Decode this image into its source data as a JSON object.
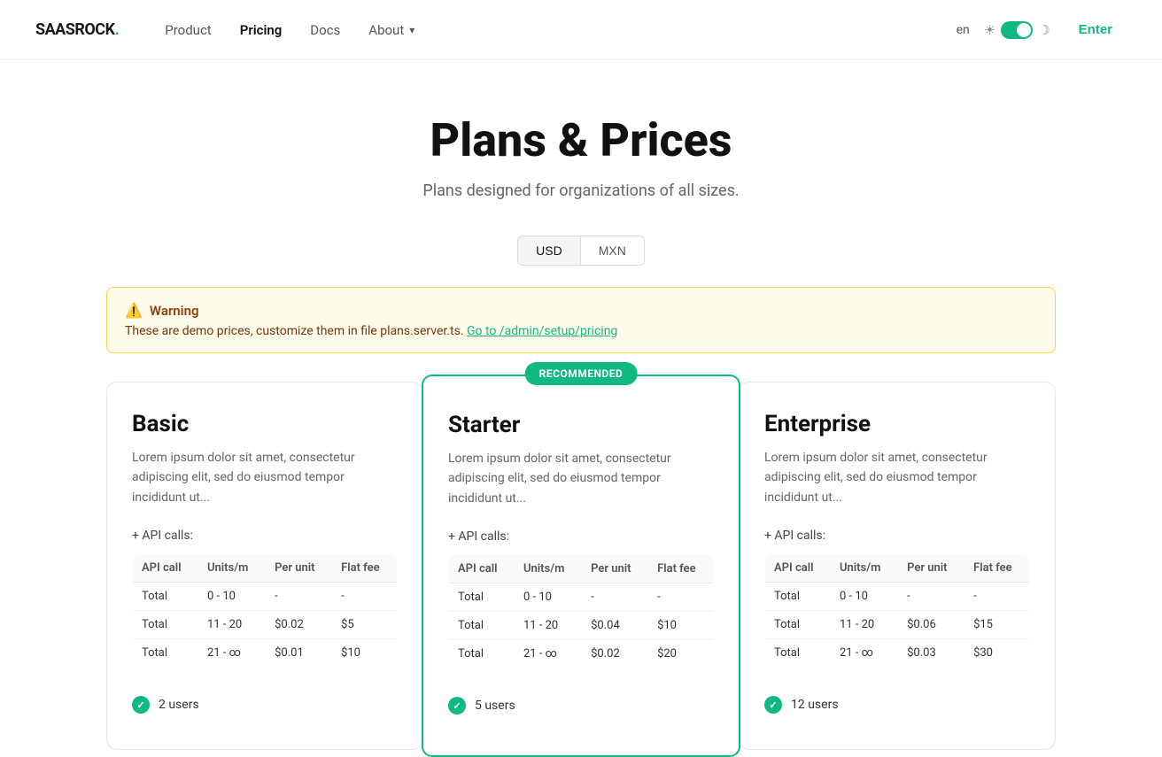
{
  "logo": {
    "saas": "SAAS",
    "rock": "ROCK",
    "dot": "."
  },
  "nav": {
    "links": [
      {
        "label": "Product",
        "active": false
      },
      {
        "label": "Pricing",
        "active": true
      },
      {
        "label": "Docs",
        "active": false
      },
      {
        "label": "About",
        "active": false,
        "hasArrow": true
      }
    ],
    "lang": "en",
    "enter_label": "Enter"
  },
  "hero": {
    "title": "Plans & Prices",
    "subtitle": "Plans designed for organizations of all sizes."
  },
  "currency": {
    "tabs": [
      "USD",
      "MXN"
    ],
    "active": "USD"
  },
  "warning": {
    "title": "Warning",
    "text": "These are demo prices, customize them in file plans.server.ts.",
    "link_text": "Go to /admin/setup/pricing"
  },
  "plans": [
    {
      "name": "Basic",
      "description": "Lorem ipsum dolor sit amet, consectetur adipiscing elit, sed do eiusmod tempor incididunt ut...",
      "api_calls_label": "+ API calls:",
      "recommended": false,
      "table": {
        "headers": [
          "API call",
          "Units/m",
          "Per unit",
          "Flat fee"
        ],
        "rows": [
          {
            "call": "Total",
            "units": "0 - 10",
            "per_unit": "-",
            "flat_fee": "-"
          },
          {
            "call": "Total",
            "units": "11 - 20",
            "per_unit": "$0.02",
            "flat_fee": "$5"
          },
          {
            "call": "Total",
            "units": "21 - ∞",
            "per_unit": "$0.01",
            "flat_fee": "$10"
          }
        ]
      },
      "features": [
        "2 users"
      ]
    },
    {
      "name": "Starter",
      "description": "Lorem ipsum dolor sit amet, consectetur adipiscing elit, sed do eiusmod tempor incididunt ut...",
      "api_calls_label": "+ API calls:",
      "recommended": true,
      "recommended_label": "RECOMMENDED",
      "table": {
        "headers": [
          "API call",
          "Units/m",
          "Per unit",
          "Flat fee"
        ],
        "rows": [
          {
            "call": "Total",
            "units": "0 - 10",
            "per_unit": "-",
            "flat_fee": "-"
          },
          {
            "call": "Total",
            "units": "11 - 20",
            "per_unit": "$0.04",
            "flat_fee": "$10"
          },
          {
            "call": "Total",
            "units": "21 - ∞",
            "per_unit": "$0.02",
            "flat_fee": "$20"
          }
        ]
      },
      "features": [
        "5 users"
      ]
    },
    {
      "name": "Enterprise",
      "description": "Lorem ipsum dolor sit amet, consectetur adipiscing elit, sed do eiusmod tempor incididunt ut...",
      "api_calls_label": "+ API calls:",
      "recommended": false,
      "table": {
        "headers": [
          "API call",
          "Units/m",
          "Per unit",
          "Flat fee"
        ],
        "rows": [
          {
            "call": "Total",
            "units": "0 - 10",
            "per_unit": "-",
            "flat_fee": "-"
          },
          {
            "call": "Total",
            "units": "11 - 20",
            "per_unit": "$0.06",
            "flat_fee": "$15"
          },
          {
            "call": "Total",
            "units": "21 - ∞",
            "per_unit": "$0.03",
            "flat_fee": "$30"
          }
        ]
      },
      "features": [
        "12 users"
      ]
    }
  ]
}
